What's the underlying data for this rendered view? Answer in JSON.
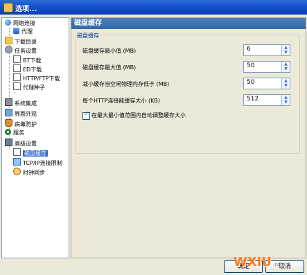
{
  "window": {
    "title": "选项..."
  },
  "tree": {
    "items": [
      {
        "label": "网络连接",
        "icon": "globe-icon"
      },
      {
        "label": "代理",
        "icon": "proxy-icon"
      },
      {
        "label": "下载目录",
        "icon": "folder-icon"
      },
      {
        "label": "任务设置",
        "icon": "gear-icon"
      },
      {
        "label": "BT下载",
        "icon": "file-icon"
      },
      {
        "label": "ED下载",
        "icon": "file-icon"
      },
      {
        "label": "HTTP/FTP下载",
        "icon": "file-icon"
      },
      {
        "label": "代理种子",
        "icon": "file-icon"
      },
      {
        "label": "系统集成",
        "icon": "chip-icon"
      },
      {
        "label": "界面外观",
        "icon": "screen-icon"
      },
      {
        "label": "病毒防护",
        "icon": "shield-icon"
      },
      {
        "label": "服务",
        "icon": "ball-icon"
      },
      {
        "label": "高级设置",
        "icon": "advanced-icon"
      },
      {
        "label": "磁盘缓存",
        "icon": "file-icon"
      },
      {
        "label": "TCP/IP连接限制",
        "icon": "network-icon"
      },
      {
        "label": "时钟同步",
        "icon": "clock-icon"
      }
    ],
    "selected_index": 13
  },
  "panel": {
    "header": "磁盘缓存",
    "group_label": "磁盘缓存",
    "rows": [
      {
        "label": "磁盘缓存最小值 (MB)",
        "value": "6"
      },
      {
        "label": "磁盘缓存最大值 (MB)",
        "value": "50"
      },
      {
        "label": "减小缓存当空闲物理内存低于 (MB)",
        "value": "50"
      },
      {
        "label": "每个HTTP连接能缓存大小 (KB)",
        "value": "512"
      }
    ],
    "checkbox": {
      "checked": true,
      "label": "在最大最小值范围内自动调整缓存大小"
    }
  },
  "buttons": {
    "ok": "确定",
    "cancel": "取消"
  },
  "watermark": {
    "text": "WXIU",
    "suffix": ".com"
  }
}
